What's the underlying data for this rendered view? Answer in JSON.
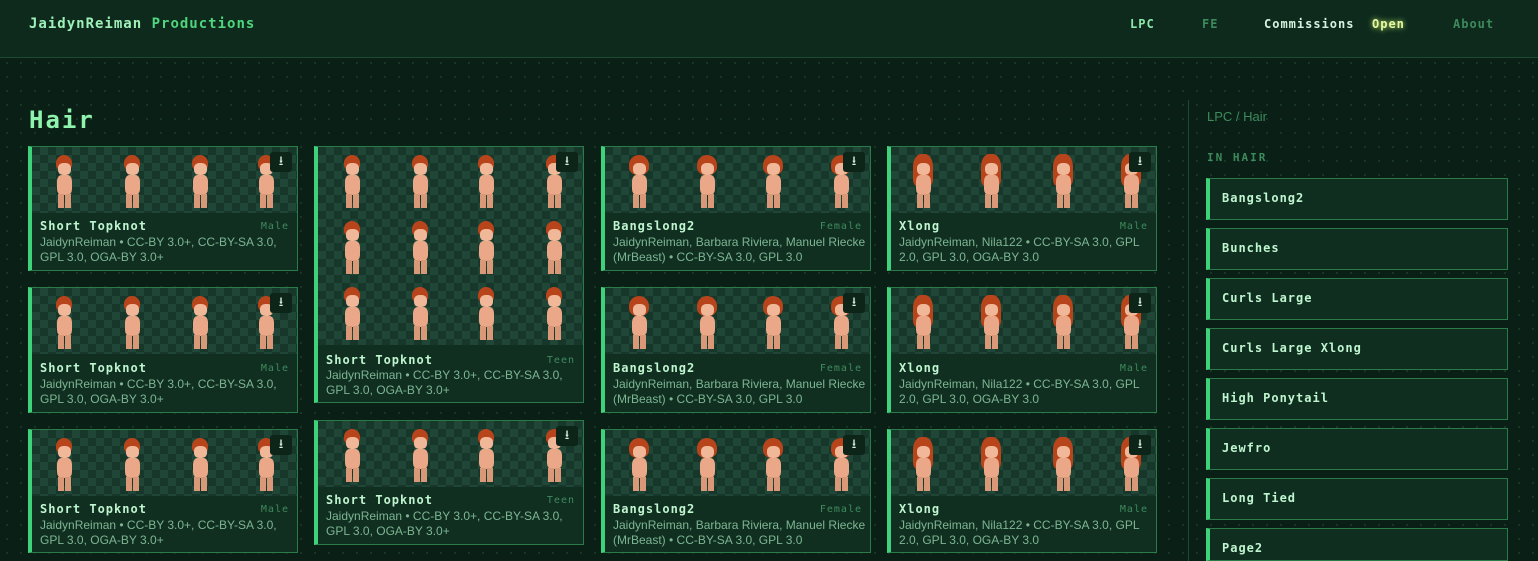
{
  "header": {
    "brand_name": "JaidynReiman",
    "brand_suffix": "Productions",
    "nav": {
      "lpc": "LPC",
      "fe": "FE",
      "commissions": "Commissions",
      "commissions_status": "Open",
      "about": "About"
    }
  },
  "page": {
    "title": "Hair"
  },
  "cards": [
    {
      "name": "Short Topknot",
      "gender": "Male",
      "credit": "JaidynReiman • CC-BY 3.0+, CC-BY-SA 3.0, GPL 3.0, OGA-BY 3.0+"
    },
    {
      "name": "Short Topknot",
      "gender": "Male",
      "credit": "JaidynReiman • CC-BY 3.0+, CC-BY-SA 3.0, GPL 3.0, OGA-BY 3.0+"
    },
    {
      "name": "Short Topknot",
      "gender": "Male",
      "credit": "JaidynReiman • CC-BY 3.0+, CC-BY-SA 3.0, GPL 3.0, OGA-BY 3.0+"
    },
    {
      "name": "Short Topknot",
      "gender": "Teen",
      "credit": "JaidynReiman • CC-BY 3.0+, CC-BY-SA 3.0, GPL 3.0, OGA-BY 3.0+"
    },
    {
      "name": "Short Topknot",
      "gender": "Teen",
      "credit": "JaidynReiman • CC-BY 3.0+, CC-BY-SA 3.0, GPL 3.0, OGA-BY 3.0+"
    },
    {
      "name": "Bangslong2",
      "gender": "Female",
      "credit": "JaidynReiman, Barbara Riviera, Manuel Riecke (MrBeast) • CC-BY-SA 3.0, GPL 3.0"
    },
    {
      "name": "Bangslong2",
      "gender": "Female",
      "credit": "JaidynReiman, Barbara Riviera, Manuel Riecke (MrBeast) • CC-BY-SA 3.0, GPL 3.0"
    },
    {
      "name": "Bangslong2",
      "gender": "Female",
      "credit": "JaidynReiman, Barbara Riviera, Manuel Riecke (MrBeast) • CC-BY-SA 3.0, GPL 3.0"
    },
    {
      "name": "Xlong",
      "gender": "Male",
      "credit": "JaidynReiman, Nila122 • CC-BY-SA 3.0, GPL 2.0, GPL 3.0, OGA-BY 3.0"
    },
    {
      "name": "Xlong",
      "gender": "Male",
      "credit": "JaidynReiman, Nila122 • CC-BY-SA 3.0, GPL 2.0, GPL 3.0, OGA-BY 3.0"
    },
    {
      "name": "Xlong",
      "gender": "Male",
      "credit": "JaidynReiman, Nila122 • CC-BY-SA 3.0, GPL 2.0, GPL 3.0, OGA-BY 3.0"
    }
  ],
  "icons": {
    "download": "download-icon"
  },
  "colors": {
    "accent": "#3ed37a",
    "background": "#0a2016",
    "open_badge": "#e9f7a3"
  },
  "sidebar": {
    "breadcrumb": "LPC / Hair",
    "heading": "IN HAIR",
    "items": [
      "Bangslong2",
      "Bunches",
      "Curls Large",
      "Curls Large Xlong",
      "High Ponytail",
      "Jewfro",
      "Long Tied",
      "Page2"
    ]
  }
}
